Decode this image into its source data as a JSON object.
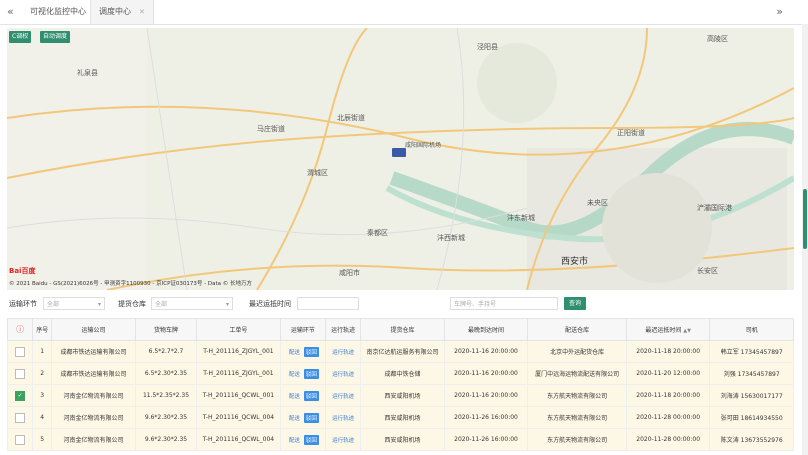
{
  "header": {
    "tabs": [
      {
        "label": "可视化监控中心"
      },
      {
        "label": "调度中心"
      }
    ]
  },
  "map": {
    "button_1": "C调权",
    "button_2": "自动调度",
    "attribution": "© 2021 Baidu - GS(2021)6026号 - 甲测资字1100930 - 京ICP证030173号 - Data © 长地万方",
    "logo": "Bai百度",
    "labels": [
      "马庄街道",
      "正阳街道",
      "咸阳市",
      "西安市",
      "秦都区",
      "沣西新城",
      "未央区",
      "高陵区",
      "咸阳国际机场",
      "北辰街道",
      "渭城区",
      "礼泉县",
      "沣东新城",
      "泾阳县",
      "浐灞国际港",
      "长安区"
    ]
  },
  "filters": {
    "route_label": "运输环节",
    "route_value": "全部",
    "warehouse_label": "提货仓库",
    "warehouse_value": "全部",
    "time_label": "最迟运抵时间",
    "search_placeholder": "车牌号、手持号",
    "query_button": "查询"
  },
  "table": {
    "headers": [
      "序号",
      "运输公司",
      "货物车牌",
      "工单号",
      "运输环节",
      "运行轨迹",
      "提货仓库",
      "最晚到达时间",
      "配送仓库",
      "最迟运抵时间",
      "司机"
    ],
    "rows": [
      {
        "no": "1",
        "company": "成都市铁达运输有限公司",
        "plate": "6.5*2.7*2.7",
        "order": "T-H_201116_ZJGYL_001",
        "action1": "配送",
        "action2": "驳回",
        "track": "运行轨迹",
        "warehouse": "南京亿达航运服务有限公司",
        "arrive": "2020-11-16 20:00:00",
        "delivery": "北京中外运配货仓库",
        "deadline": "2020-11-18 20:00:00",
        "driver": "韩立军 17345457897",
        "checked": false
      },
      {
        "no": "2",
        "company": "成都市铁达运输有限公司",
        "plate": "6.5*2.30*2.35",
        "order": "T-H_201116_ZJGYL_001",
        "action1": "配送",
        "action2": "驳回",
        "track": "运行轨迹",
        "warehouse": "成都中铁仓储",
        "arrive": "2020-11-16 20:00:00",
        "delivery": "厦门中远海运物流配送有限公司",
        "deadline": "2020-11-20 12:00:00",
        "driver": "刘强 17345457897",
        "checked": false
      },
      {
        "no": "3",
        "company": "河南金亿物流有限公司",
        "plate": "11.5*2.35*2.35",
        "order": "T-H_201116_QCWL_001",
        "action1": "配送",
        "action2": "驳回",
        "track": "运行轨迹",
        "warehouse": "西安咸阳机场",
        "arrive": "2020-11-16 20:00:00",
        "delivery": "东方航天物流有限公司",
        "deadline": "2020-11-18 20:00:00",
        "driver": "刘海涛 15630017177",
        "checked": true
      },
      {
        "no": "4",
        "company": "河南金亿物流有限公司",
        "plate": "9.6*2.30*2.35",
        "order": "T-H_201116_QCWL_004",
        "action1": "配送",
        "action2": "驳回",
        "track": "运行轨迹",
        "warehouse": "西安咸阳机场",
        "arrive": "2020-11-26 16:00:00",
        "delivery": "东方航天物流有限公司",
        "deadline": "2020-11-28 00:00:00",
        "driver": "张可田 18614934550",
        "checked": false
      },
      {
        "no": "5",
        "company": "河南金亿物流有限公司",
        "plate": "9.6*2.30*2.35",
        "order": "T-H_201116_QCWL_004",
        "action1": "配送",
        "action2": "驳回",
        "track": "运行轨迹",
        "warehouse": "西安咸阳机场",
        "arrive": "2020-11-26 16:00:00",
        "delivery": "东方航天物流有限公司",
        "deadline": "2020-11-28 00:00:00",
        "driver": "陈文涛 13673552976",
        "checked": false
      }
    ]
  },
  "colors": {
    "accent": "#2f8f6f",
    "row_highlight": "#fdf8e6",
    "action_blue": "#3a8ee6"
  }
}
